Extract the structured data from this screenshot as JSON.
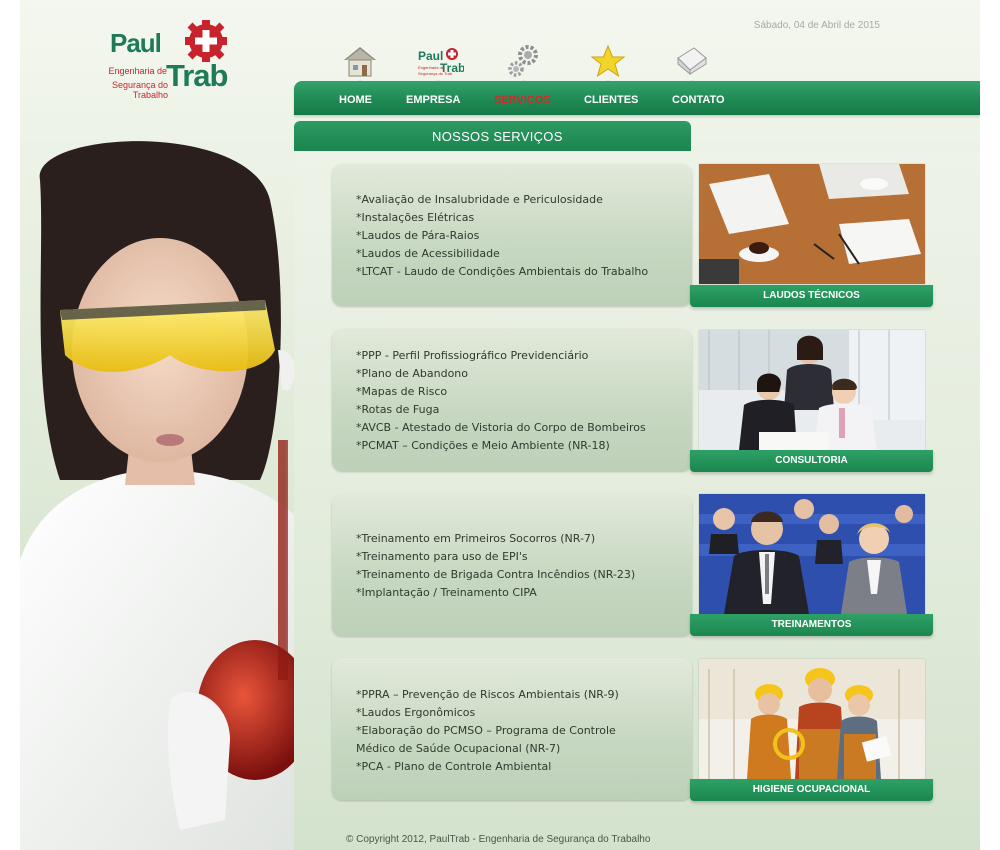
{
  "logo": {
    "name_top": "Paul",
    "name_bottom": "Trab",
    "subtitle_line1": "Engenharia de",
    "subtitle_line2": "Segurança do Trabalho"
  },
  "date": "Sábado, 04 de Abril de 2015",
  "nav": {
    "items": [
      {
        "label": "HOME",
        "icon": "home-icon"
      },
      {
        "label": "EMPRESA",
        "icon": "paultrab-logo-icon"
      },
      {
        "label": "SERVIÇOS",
        "icon": "gears-icon",
        "active": true
      },
      {
        "label": "CLIENTES",
        "icon": "star-icon"
      },
      {
        "label": "CONTATO",
        "icon": "envelope-icon"
      }
    ]
  },
  "section_title": "NOSSOS SERVIÇOS",
  "services": [
    {
      "items": [
        "*Avaliação de Insalubridade e Periculosidade",
        "*Instalações Elétricas",
        "*Laudos de Pára-Raios",
        "*Laudos de Acessibilidade",
        "*LTCAT - Laudo de Condições Ambientais do Trabalho"
      ],
      "bar_label": "LAUDOS TÉCNICOS",
      "photo": "office-desk-coffee-photo"
    },
    {
      "items": [
        "*PPP - Perfil Profissiográfico Previdenciário",
        "*Plano de Abandono",
        "*Mapas de Risco",
        "*Rotas de Fuga",
        "*AVCB - Atestado de Vistoria do Corpo de Bombeiros",
        "*PCMAT – Condições e Meio Ambiente (NR-18)"
      ],
      "bar_label": "CONSULTORIA",
      "photo": "business-meeting-photo"
    },
    {
      "items": [
        "*Treinamento em Primeiros Socorros (NR-7)",
        "*Treinamento para uso de EPI's",
        "*Treinamento de Brigada Contra Incêndios (NR-23)",
        "*Implantação / Treinamento CIPA"
      ],
      "bar_label": "TREINAMENTOS",
      "photo": "training-audience-photo"
    },
    {
      "items": [
        "*PPRA – Prevenção de Riscos Ambientais (NR-9)",
        "*Laudos Ergonômicos",
        "*Elaboração do PCMSO – Programa de Controle",
        "Médico de Saúde Ocupacional (NR-7)",
        "*PCA - Plano de Controle Ambiental"
      ],
      "bar_label": "HIGIENE OCUPACIONAL",
      "photo": "construction-workers-photo"
    }
  ],
  "copyright": "© Copyright 2012, PaulTrab - Engenharia de Segurança do Trabalho",
  "colors": {
    "brand_green": "#1f8a54",
    "brand_red": "#c8232c",
    "active_nav": "#d02a2a"
  }
}
